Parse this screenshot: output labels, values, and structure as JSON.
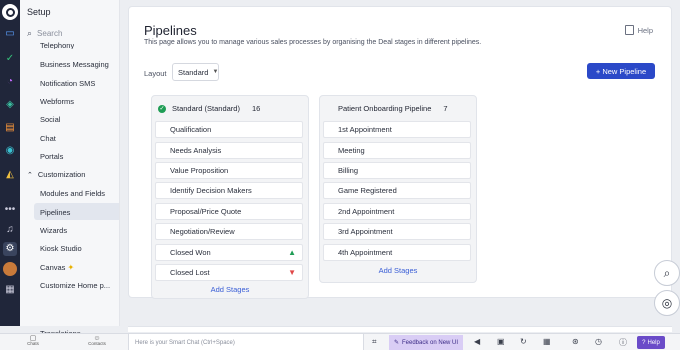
{
  "sidebar": {
    "header": "Setup",
    "search_placeholder": "Search",
    "partial_item": "Telephony",
    "items_top": [
      "Business Messaging",
      "Notification SMS",
      "Webforms",
      "Social",
      "Chat",
      "Portals"
    ],
    "group_label": "Customization",
    "items_custom": [
      "Modules and Fields",
      "Pipelines",
      "Wizards",
      "Kiosk Studio",
      "Canvas",
      "Customize Home p..."
    ],
    "active_item": "Pipelines",
    "translations": "Translations"
  },
  "page": {
    "title": "Pipelines",
    "subtitle": "This page allows you to manage various sales processes by organising the Deal stages in different pipelines.",
    "help_label": "Help",
    "layout_label": "Layout",
    "layout_value": "Standard",
    "new_pipeline_label": "+ New Pipeline"
  },
  "pipelines": [
    {
      "name": "Standard (Standard)",
      "count": "16",
      "stages": [
        "Qualification",
        "Needs Analysis",
        "Value Proposition",
        "Identify Decision Makers",
        "Proposal/Price Quote",
        "Negotiation/Review",
        "Closed Won",
        "Closed Lost"
      ],
      "add_label": "Add Stages"
    },
    {
      "name": "Patient Onboarding Pipeline",
      "count": "7",
      "stages": [
        "1st Appointment",
        "Meeting",
        "Billing",
        "Game Registered",
        "2nd Appointment",
        "3rd Appointment",
        "4th Appointment"
      ],
      "add_label": "Add Stages"
    }
  ],
  "bottombar": {
    "nav1": "Chats",
    "nav2": "Contacts",
    "smart_chat_placeholder": "Here is your Smart Chat (Ctrl+Space)",
    "feedback_label": "Feedback on New UI",
    "help_label": "Help"
  },
  "colors": {
    "rail": "#20263a",
    "primary": "#2b49c8",
    "link": "#3a5ed6",
    "won": "#1f9d55",
    "lost": "#e04848",
    "feedback_bg": "#d9cdf5",
    "help_bg": "#6a4bc8"
  }
}
